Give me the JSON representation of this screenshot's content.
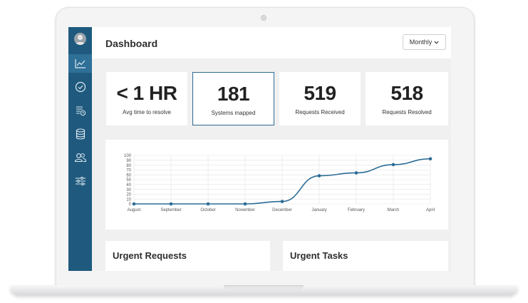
{
  "page_title": "Dashboard",
  "period_select": {
    "value": "Monthly"
  },
  "sidebar": {
    "items": [
      {
        "icon": "line-chart-icon",
        "active": true
      },
      {
        "icon": "check-circle-icon",
        "active": false
      },
      {
        "icon": "list-clock-icon",
        "active": false
      },
      {
        "icon": "database-icon",
        "active": false
      },
      {
        "icon": "users-icon",
        "active": false
      },
      {
        "icon": "sliders-icon",
        "active": false
      }
    ]
  },
  "stats": [
    {
      "value": "< 1 HR",
      "label": "Avg time to resolve"
    },
    {
      "value": "181",
      "label": "Systems mapped"
    },
    {
      "value": "519",
      "label": "Requests Received"
    },
    {
      "value": "518",
      "label": "Requests Resolved"
    }
  ],
  "chart_data": {
    "type": "line",
    "x": [
      "August",
      "September",
      "October",
      "November",
      "December",
      "January",
      "February",
      "March",
      "April"
    ],
    "series": [
      {
        "values": [
          0,
          0,
          0,
          0,
          5,
          58,
          64,
          81,
          93
        ]
      }
    ],
    "yticks": [
      0,
      10,
      20,
      30,
      40,
      50,
      60,
      70,
      80,
      90,
      100
    ],
    "ylim": [
      0,
      100
    ],
    "title": "",
    "xlabel": "",
    "ylabel": "",
    "grid": true,
    "line_color": "#2a6c95",
    "grid_color": "#e3e3e3"
  },
  "panels": {
    "urgent_requests_title": "Urgent Requests",
    "urgent_tasks_title": "Urgent Tasks"
  },
  "colors": {
    "sidebar": "#1f5a7e",
    "sidebar_active": "#2f7098",
    "selected_border": "#2f6a92"
  }
}
